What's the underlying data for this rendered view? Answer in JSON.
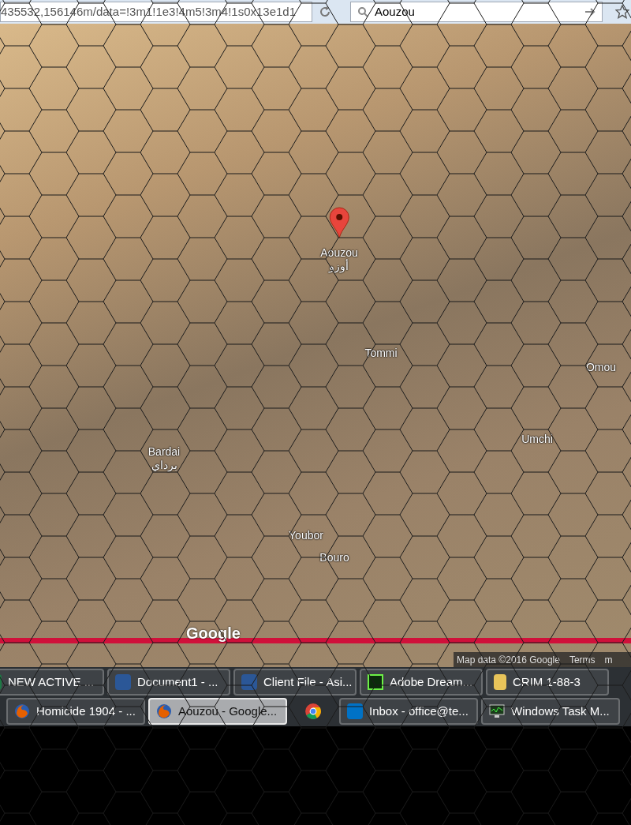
{
  "browser": {
    "url": "435532,156146m/data=!3m1!1e3!4m5!3m4!1s0x13e1d1",
    "search": "Aouzou"
  },
  "map": {
    "labels": [
      {
        "kind": "pin",
        "text": "Aouzou",
        "sub": "أوزو"
      },
      {
        "kind": "place",
        "text": "Tommi"
      },
      {
        "kind": "place",
        "text": "Omou"
      },
      {
        "kind": "place",
        "text": "Umchi"
      },
      {
        "kind": "place",
        "text": "Bardai",
        "sub": "برداي"
      },
      {
        "kind": "place",
        "text": "Youbor"
      },
      {
        "kind": "place",
        "text": "Bouro"
      }
    ],
    "logo": "Google",
    "attribution": [
      "Map data ©2016 Google",
      "Terms",
      "m"
    ]
  },
  "taskbar": {
    "rows": [
      [
        {
          "kind": "window",
          "label": "NEW ACTIVE ...",
          "selected": false
        },
        {
          "kind": "window",
          "label": "Document1 - ...",
          "selected": false
        },
        {
          "kind": "window",
          "label": "Client File - Asi...",
          "selected": false
        },
        {
          "kind": "window",
          "label": "Adobe Dream...",
          "selected": false
        },
        {
          "kind": "window",
          "label": "CRIM 1-88-3",
          "selected": false
        }
      ],
      [
        {
          "kind": "window",
          "label": "Homicide 1904 - ...",
          "selected": false
        },
        {
          "kind": "window",
          "label": "Aouzou - Google...",
          "selected": true
        },
        {
          "kind": "launcher"
        },
        {
          "kind": "window",
          "label": "Inbox - office@te...",
          "selected": false
        },
        {
          "kind": "window",
          "label": "Windows Task M...",
          "selected": false
        }
      ]
    ]
  }
}
